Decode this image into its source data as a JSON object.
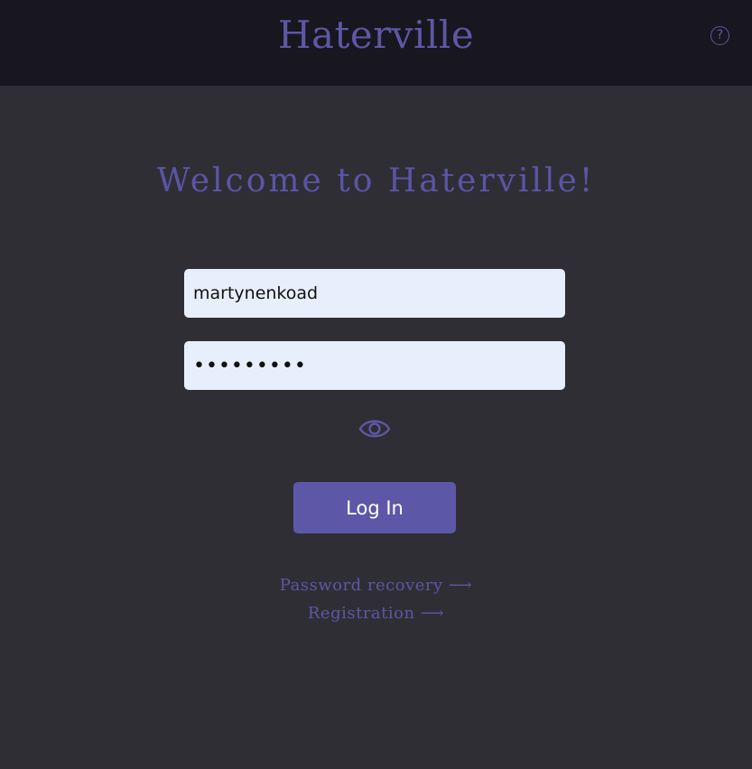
{
  "header": {
    "brand": "Haterville",
    "help_icon": "question-circle-icon",
    "help_glyph": "?"
  },
  "main": {
    "welcome": "Welcome to Haterville!",
    "username": {
      "value": "martynenkoad"
    },
    "password": {
      "value": "•••••••••"
    },
    "show_password_icon": "eye-icon",
    "login_label": "Log In",
    "links": {
      "recovery": "Password recovery ⟶",
      "registration": "Registration ⟶"
    }
  },
  "colors": {
    "accent": "#5c58a7",
    "header_bg": "#18161f",
    "page_bg": "#2f2e35",
    "input_bg": "#e8effc"
  }
}
